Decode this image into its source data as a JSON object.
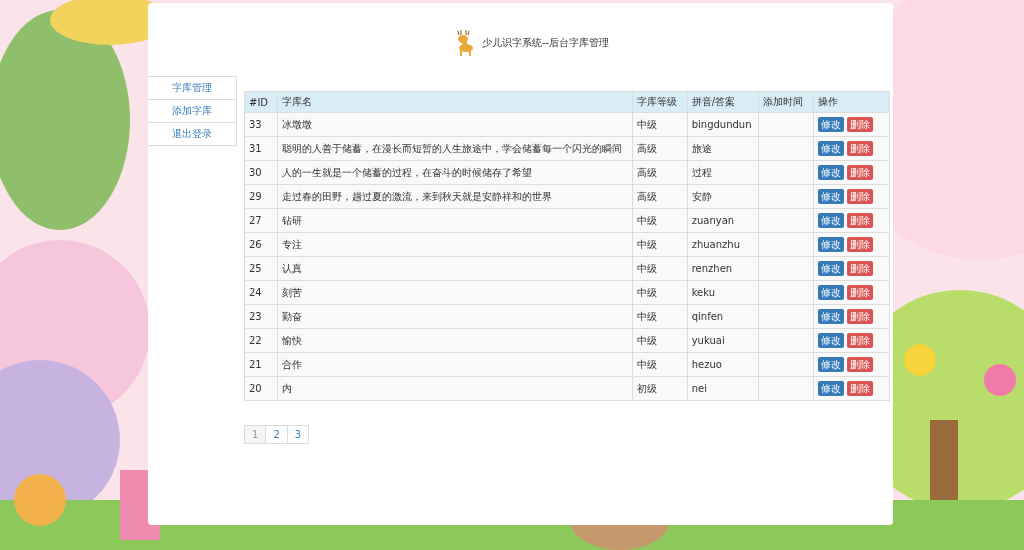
{
  "header": {
    "title": "少儿识字系统--后台字库管理"
  },
  "sidebar": {
    "items": [
      {
        "label": "字库管理"
      },
      {
        "label": "添加字库"
      },
      {
        "label": "退出登录"
      }
    ]
  },
  "table": {
    "columns": [
      "#ID",
      "字库名",
      "字库等级",
      "拼音/答案",
      "添加时间",
      "操作"
    ],
    "rows": [
      {
        "id": "33",
        "name": "冰墩墩",
        "level": "中级",
        "answer": "bingdundun",
        "actions": [
          "修改",
          "删除"
        ]
      },
      {
        "id": "31",
        "name": "聪明的人善于储蓄，在漫长而短暂的人生旅途中，学会储蓄每一个闪光的瞬间",
        "level": "高级",
        "answer": "旅途",
        "actions": [
          "修改",
          "删除"
        ]
      },
      {
        "id": "30",
        "name": "人的一生就是一个储蓄的过程，在奋斗的时候储存了希望",
        "level": "高级",
        "answer": "过程",
        "actions": [
          "修改",
          "删除"
        ]
      },
      {
        "id": "29",
        "name": "走过春的田野，趟过夏的激流，来到秋天就是安静祥和的世界",
        "level": "高级",
        "answer": "安静",
        "actions": [
          "修改",
          "删除"
        ]
      },
      {
        "id": "27",
        "name": "钻研",
        "level": "中级",
        "answer": "zuanyan",
        "actions": [
          "修改",
          "删除"
        ]
      },
      {
        "id": "26",
        "name": "专注",
        "level": "中级",
        "answer": "zhuanzhu",
        "actions": [
          "修改",
          "删除"
        ]
      },
      {
        "id": "25",
        "name": "认真",
        "level": "中级",
        "answer": "renzhen",
        "actions": [
          "修改",
          "删除"
        ]
      },
      {
        "id": "24",
        "name": "刻苦",
        "level": "中级",
        "answer": "keku",
        "actions": [
          "修改",
          "删除"
        ]
      },
      {
        "id": "23",
        "name": "勤奋",
        "level": "中级",
        "answer": "qinfen",
        "actions": [
          "修改",
          "删除"
        ]
      },
      {
        "id": "22",
        "name": "愉快",
        "level": "中级",
        "answer": "yukuai",
        "actions": [
          "修改",
          "删除"
        ]
      },
      {
        "id": "21",
        "name": "合作",
        "level": "中级",
        "answer": "hezuo",
        "actions": [
          "修改",
          "删除"
        ]
      },
      {
        "id": "20",
        "name": "内",
        "level": "初级",
        "answer": "nei",
        "actions": [
          "修改",
          "删除"
        ]
      }
    ]
  },
  "pagination": [
    {
      "label": "1",
      "selected": true
    },
    {
      "label": "2",
      "selected": false
    },
    {
      "label": "3",
      "selected": false
    }
  ]
}
